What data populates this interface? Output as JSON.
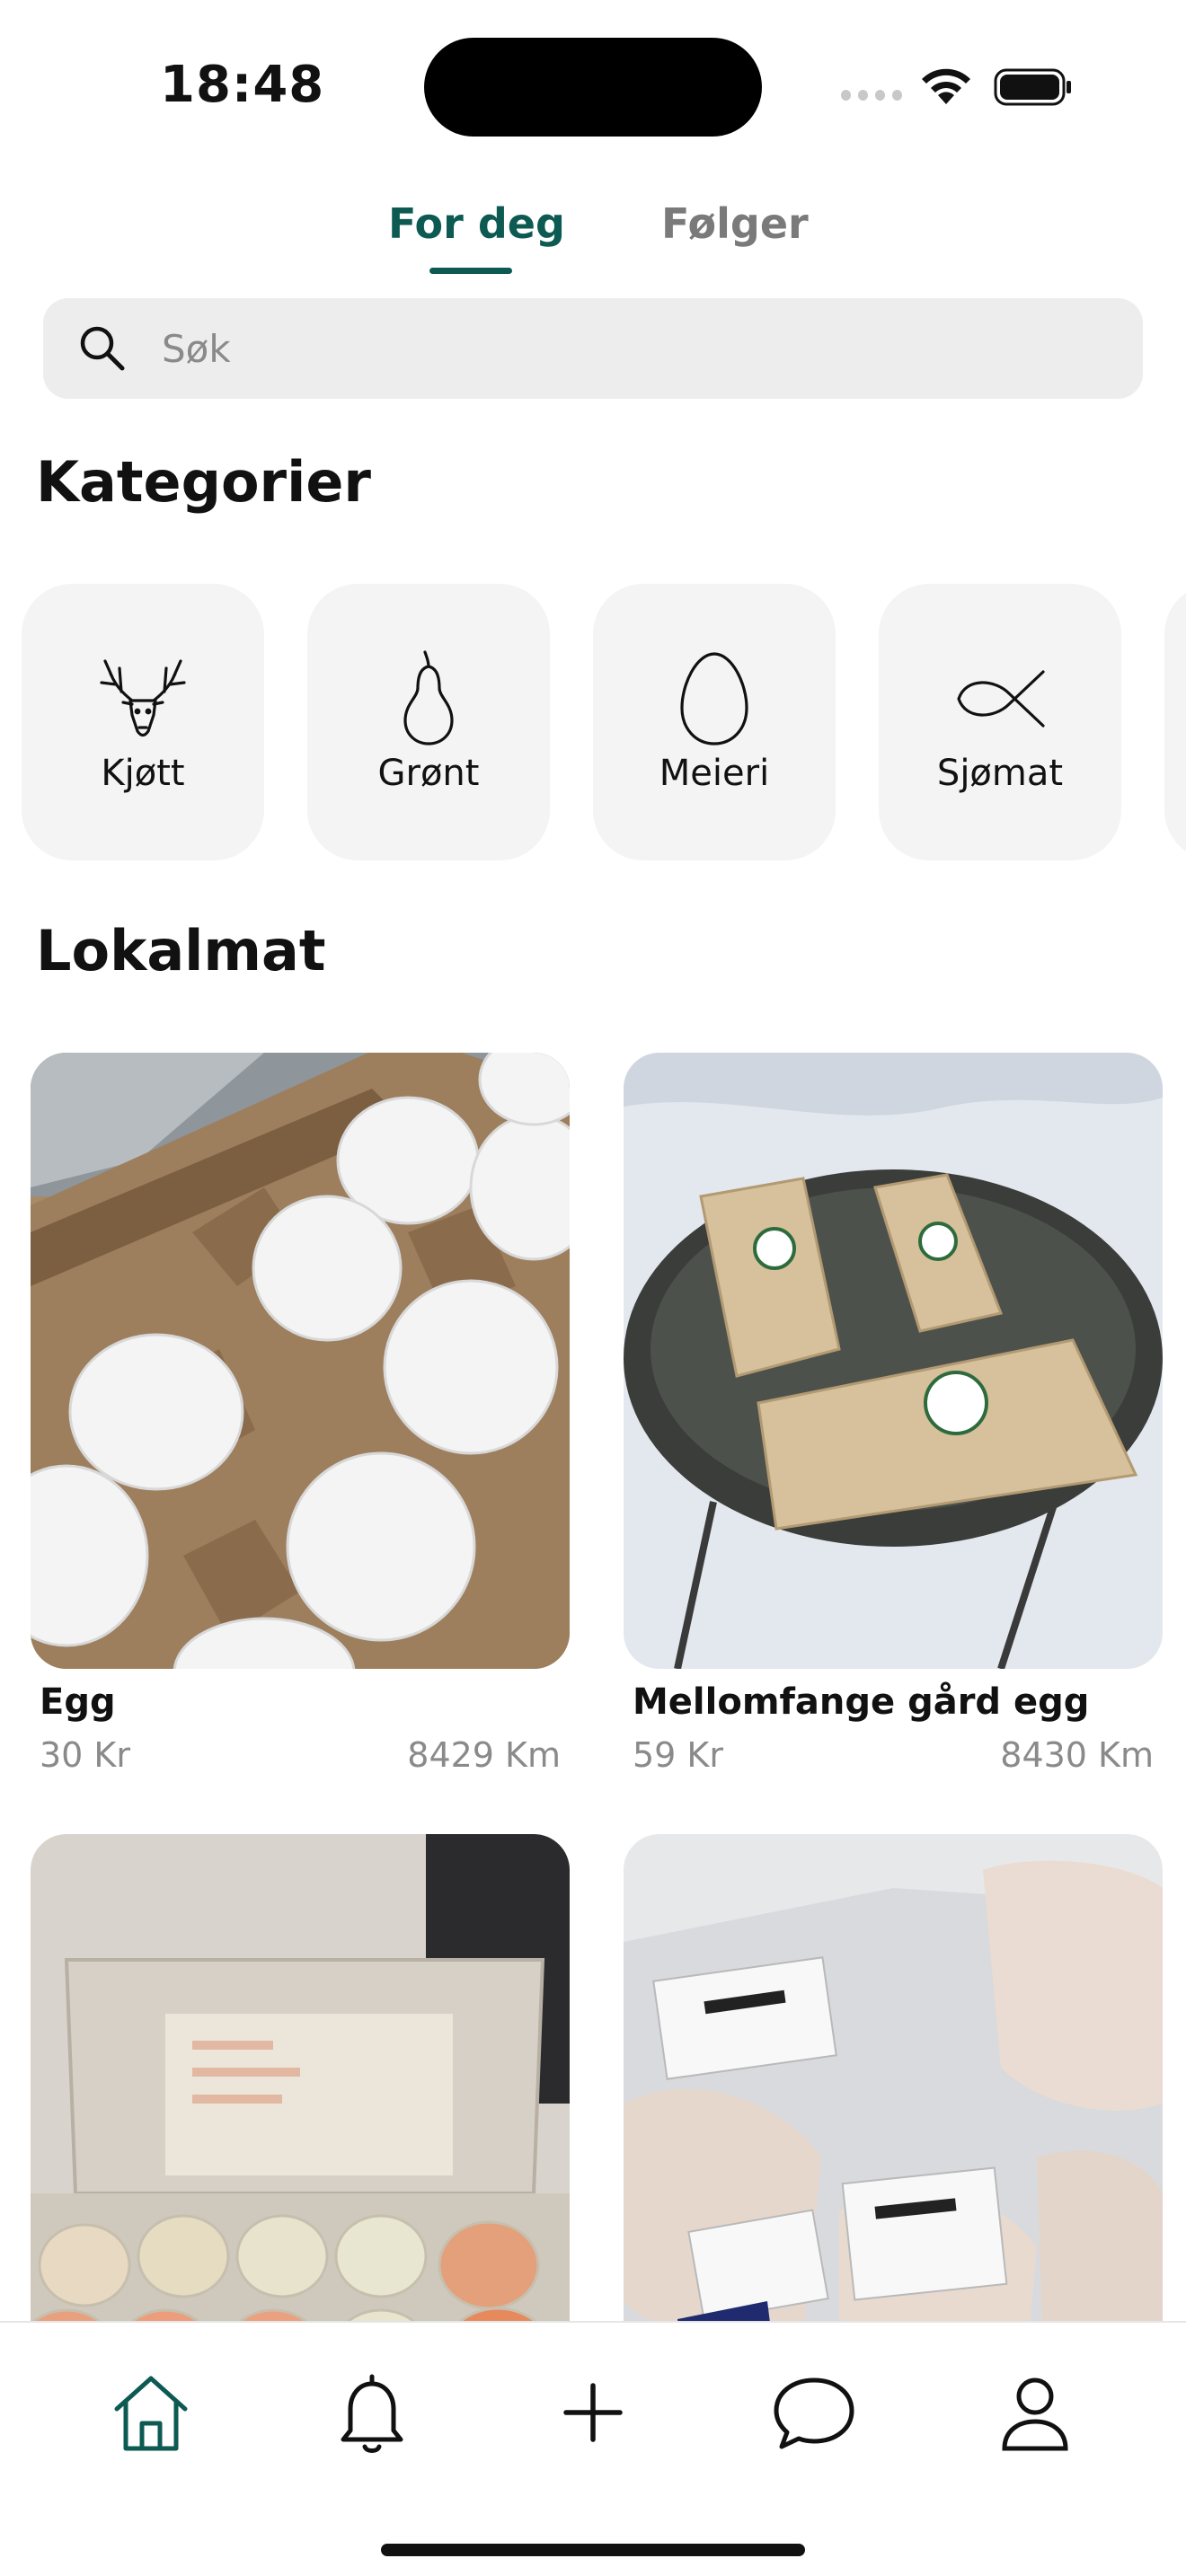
{
  "status": {
    "time": "18:48"
  },
  "tabs": [
    {
      "label": "For deg",
      "active": true
    },
    {
      "label": "Følger",
      "active": false
    }
  ],
  "search": {
    "placeholder": "Søk"
  },
  "categories_title": "Kategorier",
  "categories": [
    {
      "label": "Kjøtt",
      "icon": "antlers-icon"
    },
    {
      "label": "Grønt",
      "icon": "pear-icon"
    },
    {
      "label": "Meieri",
      "icon": "egg-icon"
    },
    {
      "label": "Sjømat",
      "icon": "fish-icon"
    }
  ],
  "local_title": "Lokalmat",
  "products": [
    {
      "name": "Egg",
      "price": "30 Kr",
      "distance": "8429 Km",
      "image": "white-eggs-in-carton-photo"
    },
    {
      "name": "Mellomfange gård egg",
      "price": "59 Kr",
      "distance": "8430 Km",
      "image": "egg-cartons-on-table-in-snow-photo"
    },
    {
      "name": "",
      "price": "",
      "distance": "",
      "image": "mixed-eggs-in-open-carton-photo"
    },
    {
      "name": "",
      "price": "",
      "distance": "",
      "image": "vacuum-packed-fish-photo"
    }
  ],
  "nav": [
    "home-icon",
    "bell-icon",
    "plus-icon",
    "chat-icon",
    "profile-icon"
  ],
  "colors": {
    "accent": "#0d5a52",
    "muted": "#8a8a8a",
    "card": "#f4f4f4",
    "search_bg": "#ededed"
  }
}
